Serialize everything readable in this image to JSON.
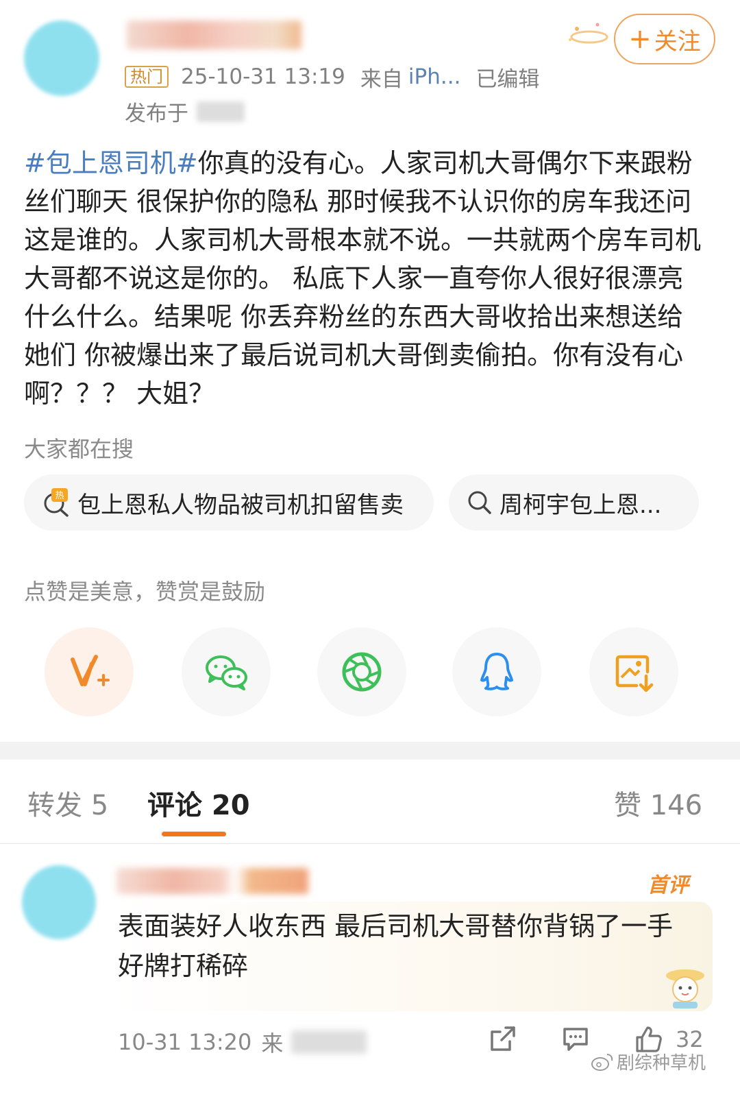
{
  "post": {
    "follow_plus": "+",
    "follow_label": "关注",
    "hot_badge": "热门",
    "timestamp": "25-10-31 13:19",
    "source_prefix": "来自",
    "source_device": "iPh...",
    "edited": "已编辑",
    "published_at": "发布于",
    "hashtag": "#包上恩司机#",
    "body": "你真的没有心。人家司机大哥偶尔下来跟粉丝们聊天 很保护你的隐私 那时候我不认识你的房车我还问这是谁的。人家司机大哥根本就不说。一共就两个房车司机大哥都不说这是你的。 私底下人家一直夸你人很好很漂亮什么什么。结果呢 你丢弃粉丝的东西大哥收拾出来想送给她们 你被爆出来了最后说司机大哥倒卖偷拍。你有没有心啊？？？ 大姐？"
  },
  "search": {
    "title": "大家都在搜",
    "chips": [
      {
        "label": "包上恩私人物品被司机扣留售卖",
        "icon": "hot-search-icon"
      },
      {
        "label": "周柯宇包上恩...",
        "icon": "search-icon"
      }
    ]
  },
  "reward": {
    "text": "点赞是美意，赞赏是鼓励",
    "buttons": [
      {
        "icon": "weibo-v-plus-icon",
        "color": "#f08a2a"
      },
      {
        "icon": "wechat-icon",
        "color": "#3fbf5a"
      },
      {
        "icon": "moments-icon",
        "color": "#3fbf5a"
      },
      {
        "icon": "qq-icon",
        "color": "#2c8ff0"
      },
      {
        "icon": "save-image-icon",
        "color": "#f0a020"
      }
    ]
  },
  "tabs": [
    {
      "label": "转发 5"
    },
    {
      "label": "评论 20"
    },
    {
      "label": "赞 146"
    }
  ],
  "comment": {
    "badge": "首评",
    "text": "表面装好人收东西  最后司机大哥替你背锅了一手好牌打稀碎",
    "timestamp": "10-31 13:20",
    "source_prefix": "来",
    "like_count": "32"
  },
  "watermark": "剧综种草机",
  "colors": {
    "accent": "#f3761f",
    "link": "#4a7dbf"
  }
}
